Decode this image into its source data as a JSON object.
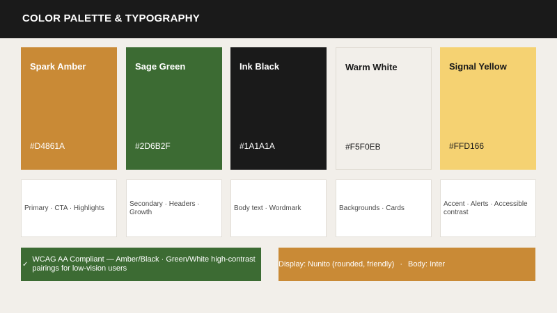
{
  "header": {
    "title": "COLOR PALETTE & TYPOGRAPHY"
  },
  "swatches": [
    {
      "name": "Spark Amber",
      "hex": "#D4861A",
      "display": "#C98A36",
      "text_color": "#FFFFFF",
      "usage": "Primary · CTA · Highlights"
    },
    {
      "name": "Sage Green",
      "hex": "#2D6B2F",
      "display": "#3C6B33",
      "text_color": "#FFFFFF",
      "usage": "Secondary · Headers · Growth"
    },
    {
      "name": "Ink Black",
      "hex": "#1A1A1A",
      "display": "#1A1A1A",
      "text_color": "#FFFFFF",
      "usage": "Body text · Wordmark"
    },
    {
      "name": "Warm White",
      "hex": "#F5F0EB",
      "display": "#F2EFEA",
      "text_color": "#1A1A1A",
      "usage": "Backgrounds · Cards"
    },
    {
      "name": "Signal Yellow",
      "hex": "#FFD166",
      "display": "#F5D272",
      "text_color": "#1A1A1A",
      "usage": "Accent · Alerts · Accessible contrast"
    }
  ],
  "banners": {
    "wcag": {
      "check": "✓",
      "text": "WCAG AA Compliant — Amber/Black · Green/White high-contrast pairings for low-vision users"
    },
    "typography": {
      "display": "Display: Nunito (rounded, friendly)",
      "separator": "·",
      "body": "Body: Inter"
    }
  }
}
